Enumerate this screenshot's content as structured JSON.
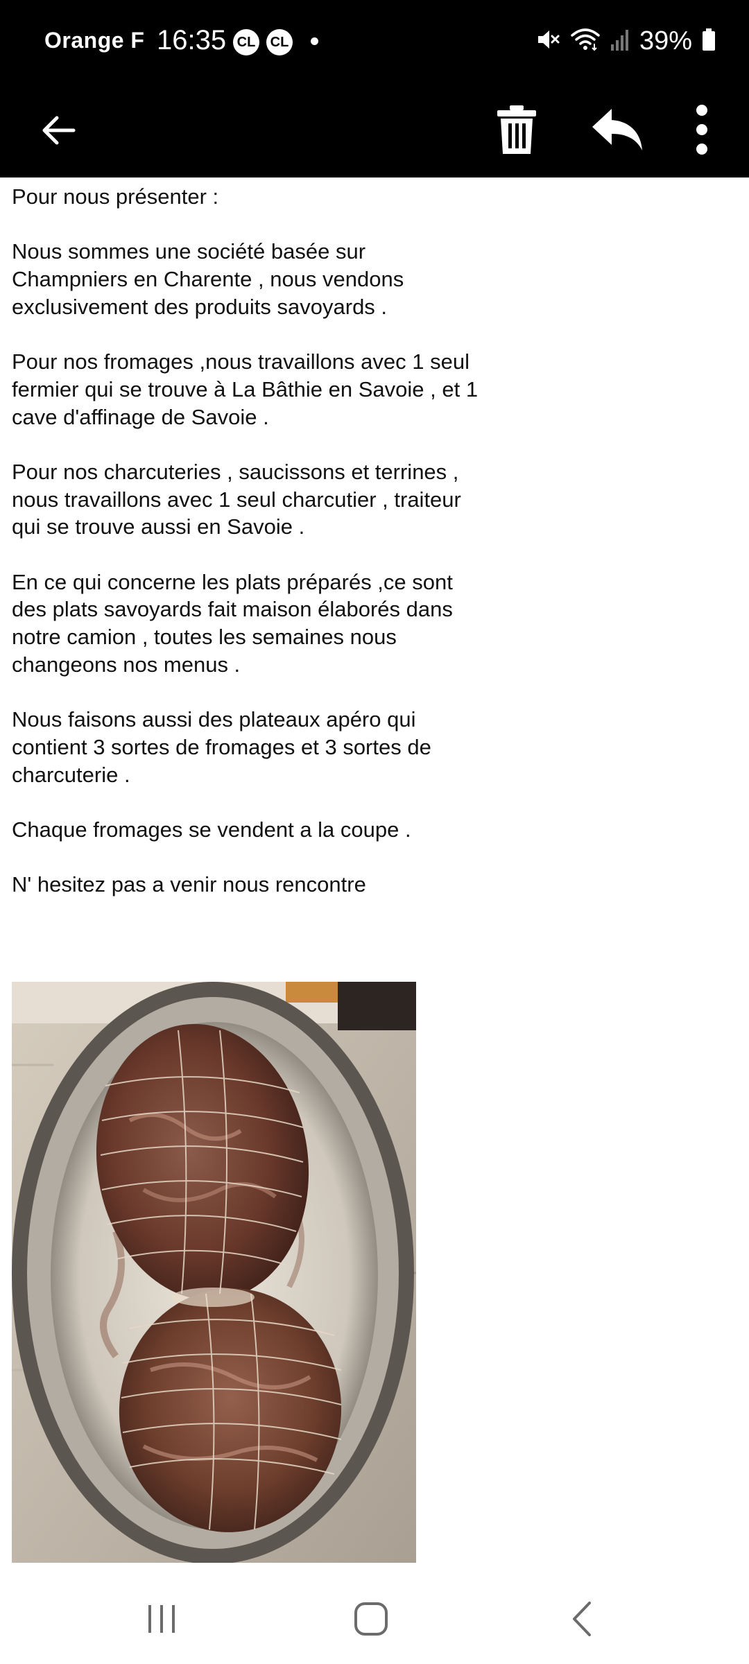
{
  "status_bar": {
    "carrier": "Orange F",
    "time": "16:35",
    "notification_badges": [
      "CL",
      "CL"
    ],
    "battery": "39%"
  },
  "toolbar": {
    "back_icon": "arrow-left-icon",
    "delete_icon": "trash-icon",
    "reply_icon": "reply-icon",
    "more_icon": "more-vertical-icon"
  },
  "email": {
    "paragraphs": [
      [
        "Pour nous présenter :"
      ],
      [
        "Nous sommes une société basée sur",
        "Champniers en Charente , nous vendons",
        "exclusivement des produits savoyards ."
      ],
      [
        "Pour nos fromages ,nous travaillons avec 1 seul",
        "fermier qui se trouve à La Bâthie en Savoie , et 1",
        "cave d'affinage de Savoie ."
      ],
      [
        "Pour nos charcuteries , saucissons et terrines ,",
        "nous travaillons avec 1 seul charcutier , traiteur",
        "qui se trouve aussi en Savoie ."
      ],
      [
        "En ce qui concerne les plats préparés ,ce sont",
        "des plats savoyards  fait maison élaborés dans",
        "notre camion , toutes les semaines nous",
        "changeons nos menus ."
      ],
      [
        "Nous faisons aussi des plateaux apéro qui",
        "contient 3 sortes de fromages et 3 sortes de",
        "charcuterie ."
      ],
      [
        "Chaque fromages  se vendent a la coupe ."
      ],
      [
        "N' hesitez pas a venir nous rencontre"
      ]
    ]
  },
  "nav_bar": {
    "recents_icon": "recent-apps-icon",
    "home_icon": "home-icon",
    "back_icon": "nav-back-icon"
  },
  "colors": {
    "status_bar_bg": "#000000",
    "toolbar_bg": "#000000",
    "text": "#111111",
    "nav_icons": "#6b6b6b"
  }
}
